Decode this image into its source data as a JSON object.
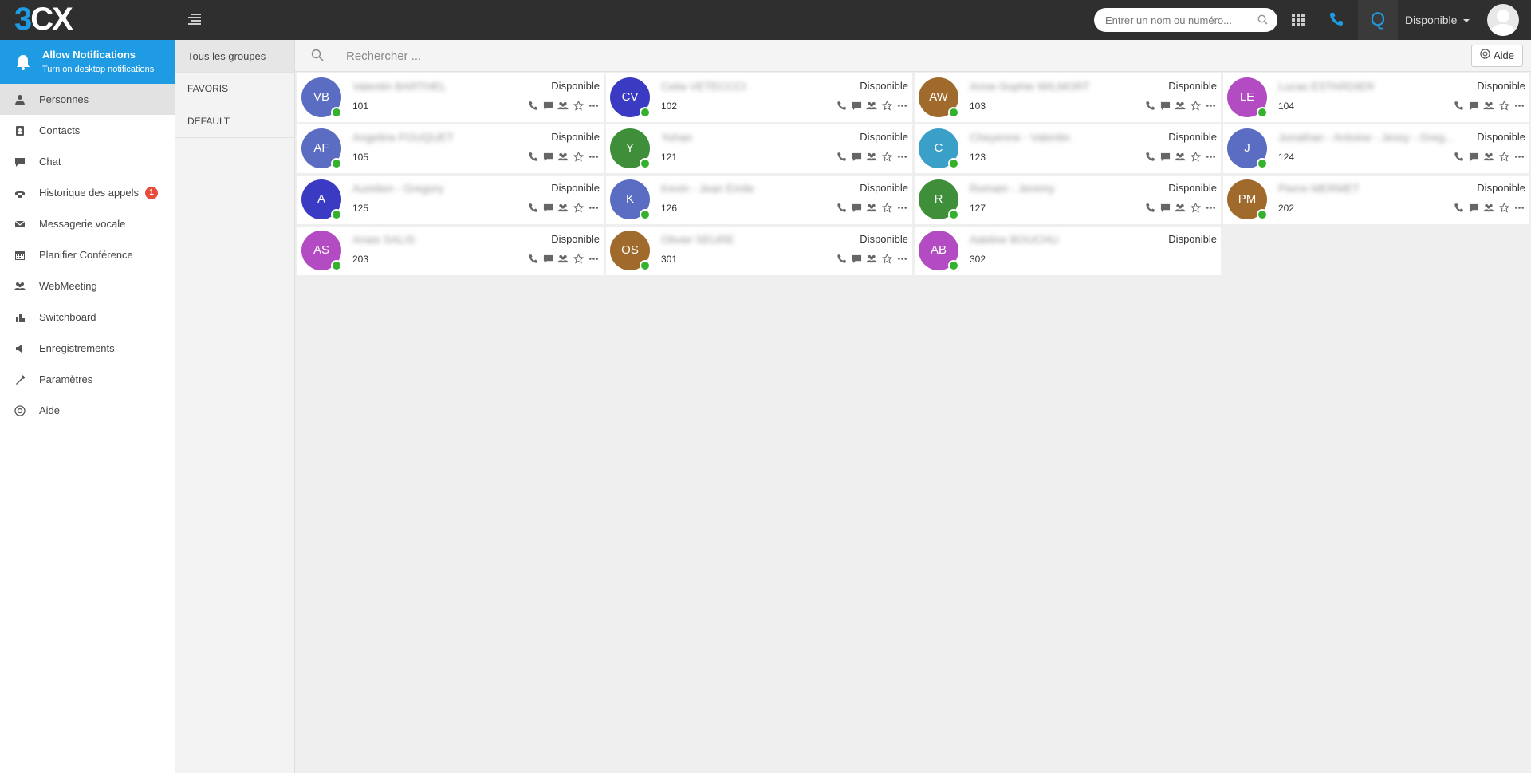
{
  "topbar": {
    "logo_three": "3",
    "logo_cx": "CX",
    "search_placeholder": "Entrer un nom ou numéro...",
    "q_label": "Q",
    "status": "Disponible"
  },
  "notification": {
    "title": "Allow Notifications",
    "subtitle": "Turn on desktop notifications"
  },
  "sidebar": {
    "items": [
      {
        "label": "Personnes",
        "icon": "person-icon"
      },
      {
        "label": "Contacts",
        "icon": "contacts-icon"
      },
      {
        "label": "Chat",
        "icon": "chat-icon"
      },
      {
        "label": "Historique des appels",
        "icon": "call-history-icon",
        "badge": "1"
      },
      {
        "label": "Messagerie vocale",
        "icon": "voicemail-icon"
      },
      {
        "label": "Planifier Conférence",
        "icon": "calendar-icon"
      },
      {
        "label": "WebMeeting",
        "icon": "group-icon"
      },
      {
        "label": "Switchboard",
        "icon": "bar-chart-icon"
      },
      {
        "label": "Enregistrements",
        "icon": "speaker-icon"
      },
      {
        "label": "Paramètres",
        "icon": "wrench-icon"
      },
      {
        "label": "Aide",
        "icon": "lifebuoy-icon"
      }
    ]
  },
  "groups": [
    "Tous les groupes",
    "FAVORIS",
    "DEFAULT"
  ],
  "main": {
    "search_placeholder": "Rechercher ...",
    "help_label": "Aide"
  },
  "colors": {
    "accent": "#1e9be3",
    "online": "#35b22d"
  },
  "contacts": [
    {
      "initials": "VB",
      "name": "Valentin BARTHEL",
      "status": "Disponible",
      "ext": "101",
      "color": "#5b6dc2",
      "actions": true
    },
    {
      "initials": "CV",
      "name": "Celia VETECCCI",
      "status": "Disponible",
      "ext": "102",
      "color": "#3a3ac2",
      "actions": true
    },
    {
      "initials": "AW",
      "name": "Anne-Sophie WILMORT",
      "status": "Disponible",
      "ext": "103",
      "color": "#a06a2c",
      "actions": true
    },
    {
      "initials": "LE",
      "name": "Lucas ESTARDIER",
      "status": "Disponible",
      "ext": "104",
      "color": "#b34bc2",
      "actions": true
    },
    {
      "initials": "AF",
      "name": "Angeline FOUQUET",
      "status": "Disponible",
      "ext": "105",
      "color": "#5b6dc2",
      "actions": true
    },
    {
      "initials": "Y",
      "name": "Yohan",
      "status": "Disponible",
      "ext": "121",
      "color": "#3f8f3a",
      "actions": true
    },
    {
      "initials": "C",
      "name": "Cheyenne - Valentin",
      "status": "Disponible",
      "ext": "123",
      "color": "#3aa0c7",
      "actions": true
    },
    {
      "initials": "J",
      "name": "Jonathan - Antoine - Jessy - Greg...",
      "status": "Disponible",
      "ext": "124",
      "color": "#5b6dc2",
      "actions": true
    },
    {
      "initials": "A",
      "name": "Aurelien - Gregory",
      "status": "Disponible",
      "ext": "125",
      "color": "#3a3ac2",
      "actions": true
    },
    {
      "initials": "K",
      "name": "Kevin - Jean Emile",
      "status": "Disponible",
      "ext": "126",
      "color": "#5b6dc2",
      "actions": true
    },
    {
      "initials": "R",
      "name": "Romain - Jeremy",
      "status": "Disponible",
      "ext": "127",
      "color": "#3f8f3a",
      "actions": true
    },
    {
      "initials": "PM",
      "name": "Pierre MERMET",
      "status": "Disponible",
      "ext": "202",
      "color": "#a06a2c",
      "actions": true
    },
    {
      "initials": "AS",
      "name": "Anais SALIS",
      "status": "Disponible",
      "ext": "203",
      "color": "#b34bc2",
      "actions": true
    },
    {
      "initials": "OS",
      "name": "Olivier SEURE",
      "status": "Disponible",
      "ext": "301",
      "color": "#a06a2c",
      "actions": true
    },
    {
      "initials": "AB",
      "name": "Adeline BOUCHU",
      "status": "Disponible",
      "ext": "302",
      "color": "#b34bc2",
      "actions": false
    }
  ]
}
